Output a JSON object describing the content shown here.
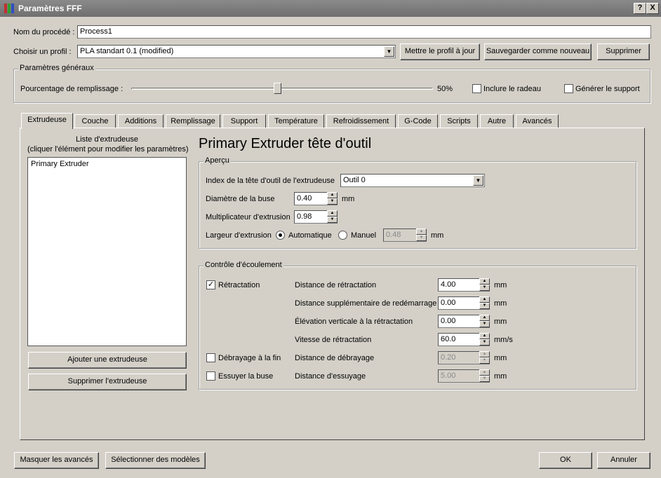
{
  "window": {
    "title": "Paramètres FFF",
    "help_label": "?",
    "close_label": "X"
  },
  "process": {
    "name_label": "Nom du procédé :",
    "name_value": "Process1",
    "profile_label": "Choisir un profil :",
    "profile_value": "PLA standart 0.1 (modified)",
    "update_button": "Mettre le profil à jour",
    "save_new_button": "Sauvegarder comme nouveau",
    "delete_button": "Supprimer"
  },
  "general": {
    "title": "Paramètres généraux",
    "fill_label": "Pourcentage de remplissage :",
    "fill_percent": 50,
    "fill_value_text": "50%",
    "raft_label": "Inclure le radeau",
    "raft_checked": false,
    "support_label": "Générer le support",
    "support_checked": false
  },
  "tabs": [
    {
      "label": "Extrudeuse",
      "active": true
    },
    {
      "label": "Couche"
    },
    {
      "label": "Additions"
    },
    {
      "label": "Remplissage"
    },
    {
      "label": "Support"
    },
    {
      "label": "Température"
    },
    {
      "label": "Refroidissement"
    },
    {
      "label": "G-Code"
    },
    {
      "label": "Scripts"
    },
    {
      "label": "Autre"
    },
    {
      "label": "Avancés"
    }
  ],
  "extruder_list": {
    "header_line1": "Liste d'extrudeuse",
    "header_line2": "(cliquer l'élément pour modifier les paramètres)",
    "items": [
      "Primary Extruder"
    ],
    "add_button": "Ajouter une extrudeuse",
    "remove_button": "Supprimer l'extrudeuse"
  },
  "extruder": {
    "heading": "Primary Extruder tête d'outil",
    "overview": {
      "title": "Aperçu",
      "tool_index_label": "Index de la tête d'outil de l'extrudeuse",
      "tool_index_value": "Outil 0",
      "nozzle_label": "Diamètre de la buse",
      "nozzle_value": "0.40",
      "nozzle_unit": "mm",
      "multiplier_label": "Multiplicateur d'extrusion",
      "multiplier_value": "0.98",
      "width_label": "Largeur d'extrusion",
      "auto_label": "Automatique",
      "manual_label": "Manuel",
      "manual_value": "0.48",
      "width_unit": "mm"
    },
    "flow": {
      "title": "Contrôle d'écoulement",
      "retraction_label": "Rétractation",
      "retraction_checked": true,
      "coast_label": "Débrayage à la fin",
      "coast_checked": false,
      "wipe_label": "Essuyer la buse",
      "wipe_checked": false,
      "rows": [
        {
          "label": "Distance de rétractation",
          "value": "4.00",
          "unit": "mm",
          "disabled": false
        },
        {
          "label": "Distance supplémentaire de redémarrage",
          "value": "0.00",
          "unit": "mm",
          "disabled": false
        },
        {
          "label": "Élévation verticale à la rétractation",
          "value": "0.00",
          "unit": "mm",
          "disabled": false
        },
        {
          "label": "Vitesse de rétractation",
          "value": "60.0",
          "unit": "mm/s",
          "disabled": false
        },
        {
          "label": "Distance de débrayage",
          "value": "0.20",
          "unit": "mm",
          "disabled": true
        },
        {
          "label": "Distance d'essuyage",
          "value": "5.00",
          "unit": "mm",
          "disabled": true
        }
      ]
    }
  },
  "footer": {
    "hide_advanced": "Masquer les avancés",
    "select_models": "Sélectionner des modèles",
    "ok": "OK",
    "cancel": "Annuler"
  }
}
